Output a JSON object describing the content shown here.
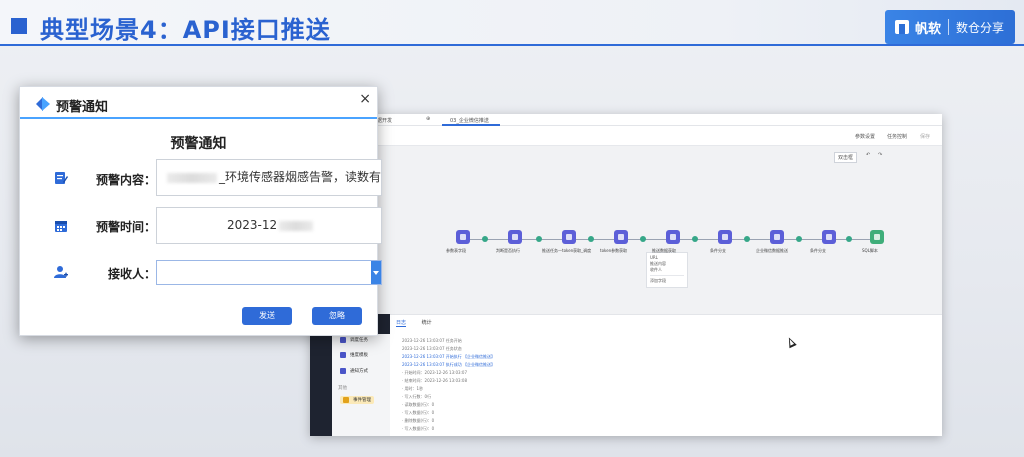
{
  "slide": {
    "title": "典型场景4：API接口推送",
    "brand_name": "帆软",
    "brand_sub": "数仓分享"
  },
  "app": {
    "tab_active": "03_企业微信推送",
    "tab_left": "数据开发",
    "toolbar": [
      "参数设置",
      "任务控制",
      "保存"
    ],
    "canvas_tools": [
      "双击框",
      "↶",
      "↷"
    ],
    "nodes": [
      "参数表字段",
      "判断是否执行",
      "推送任务—token获取_调度",
      "token参数获取",
      "推送数据获取",
      "条件分支",
      "企业微信数据推送",
      "条件分支",
      "SQL脚本"
    ],
    "popup": [
      "URL",
      "推送内容",
      "收件人",
      "",
      "添加字段"
    ],
    "panel_tabs": [
      "日志",
      "统计"
    ],
    "side_items": [
      "调度任务",
      "维度模板",
      "通知方式"
    ],
    "side_group": "其他",
    "side_highlight": "事件管理",
    "logs": [
      "2023-12-26 13:03:07  任务开始",
      "2023-12-26 13:03:07  任务状态",
      "2023-12-26 13:03:07  开始执行 【企业微信推送】",
      "2023-12-26 13:03:07  执行成功 【企业微信推送】",
      "· 开始时间：2023-12-26 13:03:07",
      "· 结束时间：2023-12-26 13:03:08",
      "· 用时：1秒",
      "· 写入行数：0行",
      "· 读取数据(行)：0",
      "· 写入数据(行)：0",
      "· 删除数据(行)：0",
      "· 写入数据(行)：0"
    ]
  },
  "dialog": {
    "title": "预警通知",
    "heading": "预警通知",
    "content_label": "预警内容：",
    "content_value": "_环境传感器烟感告警，读数有告...",
    "time_label": "预警时间：",
    "time_value": "2023-12",
    "recipient_label": "接收人：",
    "recipient_value": "",
    "send_button": "发送",
    "ignore_button": "忽略"
  }
}
